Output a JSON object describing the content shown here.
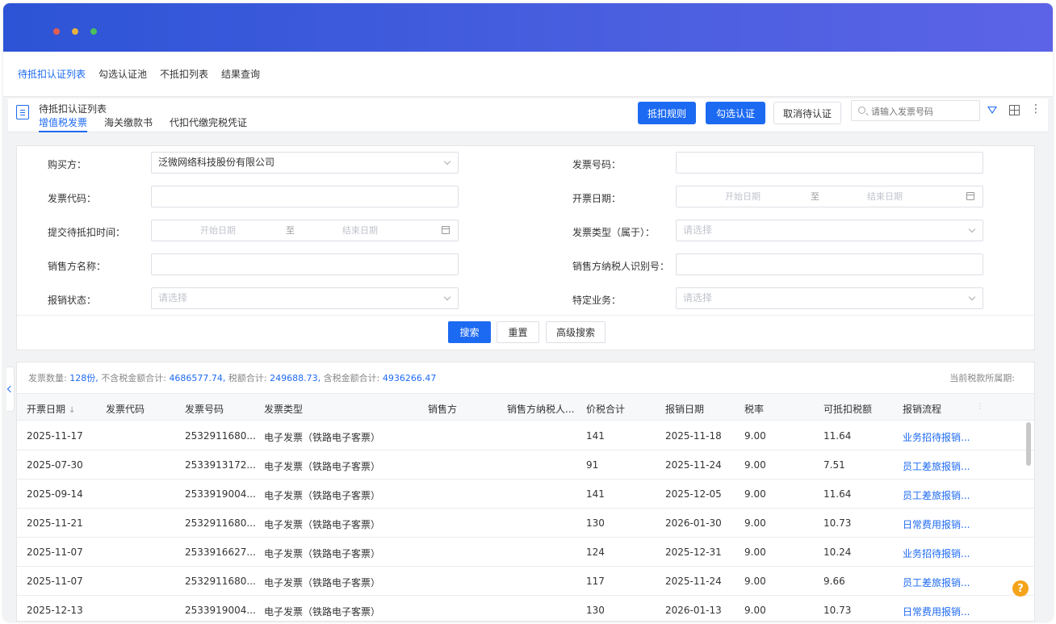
{
  "window": {
    "colors": {
      "title_gradient_start": "#2d54d6",
      "title_gradient_end": "#5c63e6",
      "accent": "#1d6af2",
      "help": "#f4a41b"
    }
  },
  "topnav": {
    "items": [
      "待抵扣认证列表",
      "勾选认证池",
      "不抵扣列表",
      "结果查询"
    ]
  },
  "panel": {
    "title": "待抵扣认证列表",
    "subtabs": [
      "增值税发票",
      "海关缴款书",
      "代扣代缴完税凭证"
    ],
    "buttons": {
      "rules": "抵扣规则",
      "select_certify": "勾选认证",
      "cancel_pending": "取消待认证"
    },
    "search_placeholder": "请输入发票号码"
  },
  "filters": {
    "buyer": {
      "label": "购买方：",
      "value": "泛微网络科技股份有限公司"
    },
    "invoice_no": {
      "label": "发票号码：",
      "value": ""
    },
    "invoice_code": {
      "label": "发票代码：",
      "value": ""
    },
    "issue_date": {
      "label": "开票日期：",
      "start": "开始日期",
      "sep": "至",
      "end": "结束日期"
    },
    "submit_time": {
      "label": "提交待抵扣时间：",
      "start": "开始日期",
      "sep": "至",
      "end": "结束日期"
    },
    "invoice_type": {
      "label": "发票类型（属于）：",
      "placeholder": "请选择"
    },
    "seller_name": {
      "label": "销售方名称：",
      "value": ""
    },
    "seller_tax_id": {
      "label": "销售方纳税人识别号：",
      "value": ""
    },
    "reimburse_status": {
      "label": "报销状态：",
      "placeholder": "请选择"
    },
    "special_business": {
      "label": "特定业务：",
      "placeholder": "请选择"
    },
    "buttons": {
      "search": "搜索",
      "reset": "重置",
      "advanced": "高级搜索"
    }
  },
  "summary": {
    "count_label": "发票数量:",
    "count_value": "128份,",
    "amount_label": "不含税金额合计:",
    "amount_value": "4686577.74,",
    "tax_label": "税额合计:",
    "tax_value": "249688.73,",
    "total_label": "含税金额合计:",
    "total_value": "4936266.47",
    "period_label": "当前税款所属期:"
  },
  "table": {
    "columns": [
      "开票日期",
      "发票代码",
      "发票号码",
      "发票类型",
      "销售方",
      "销售方纳税人...",
      "价税合计",
      "报销日期",
      "税率",
      "可抵扣税额",
      "报销流程"
    ],
    "rows": [
      [
        "2025-11-17",
        "",
        "2532911680...",
        "电子发票（铁路电子客票）",
        "",
        "",
        "141",
        "2025-11-18",
        "9.00",
        "11.64",
        "业务招待报销..."
      ],
      [
        "2025-07-30",
        "",
        "2533913172...",
        "电子发票（铁路电子客票）",
        "",
        "",
        "91",
        "2025-11-24",
        "9.00",
        "7.51",
        "员工差旅报销..."
      ],
      [
        "2025-09-14",
        "",
        "2533919004...",
        "电子发票（铁路电子客票）",
        "",
        "",
        "141",
        "2025-12-05",
        "9.00",
        "11.64",
        "员工差旅报销..."
      ],
      [
        "2025-11-21",
        "",
        "2532911680...",
        "电子发票（铁路电子客票）",
        "",
        "",
        "130",
        "2026-01-30",
        "9.00",
        "10.73",
        "日常费用报销..."
      ],
      [
        "2025-11-07",
        "",
        "2533916627...",
        "电子发票（铁路电子客票）",
        "",
        "",
        "124",
        "2025-12-31",
        "9.00",
        "10.24",
        "业务招待报销..."
      ],
      [
        "2025-11-07",
        "",
        "2532911680...",
        "电子发票（铁路电子客票）",
        "",
        "",
        "117",
        "2025-11-24",
        "9.00",
        "9.66",
        "员工差旅报销..."
      ],
      [
        "2025-12-13",
        "",
        "2533919004...",
        "电子发票（铁路电子客票）",
        "",
        "",
        "130",
        "2026-01-13",
        "9.00",
        "10.73",
        "日常费用报销..."
      ]
    ]
  },
  "help": "?"
}
